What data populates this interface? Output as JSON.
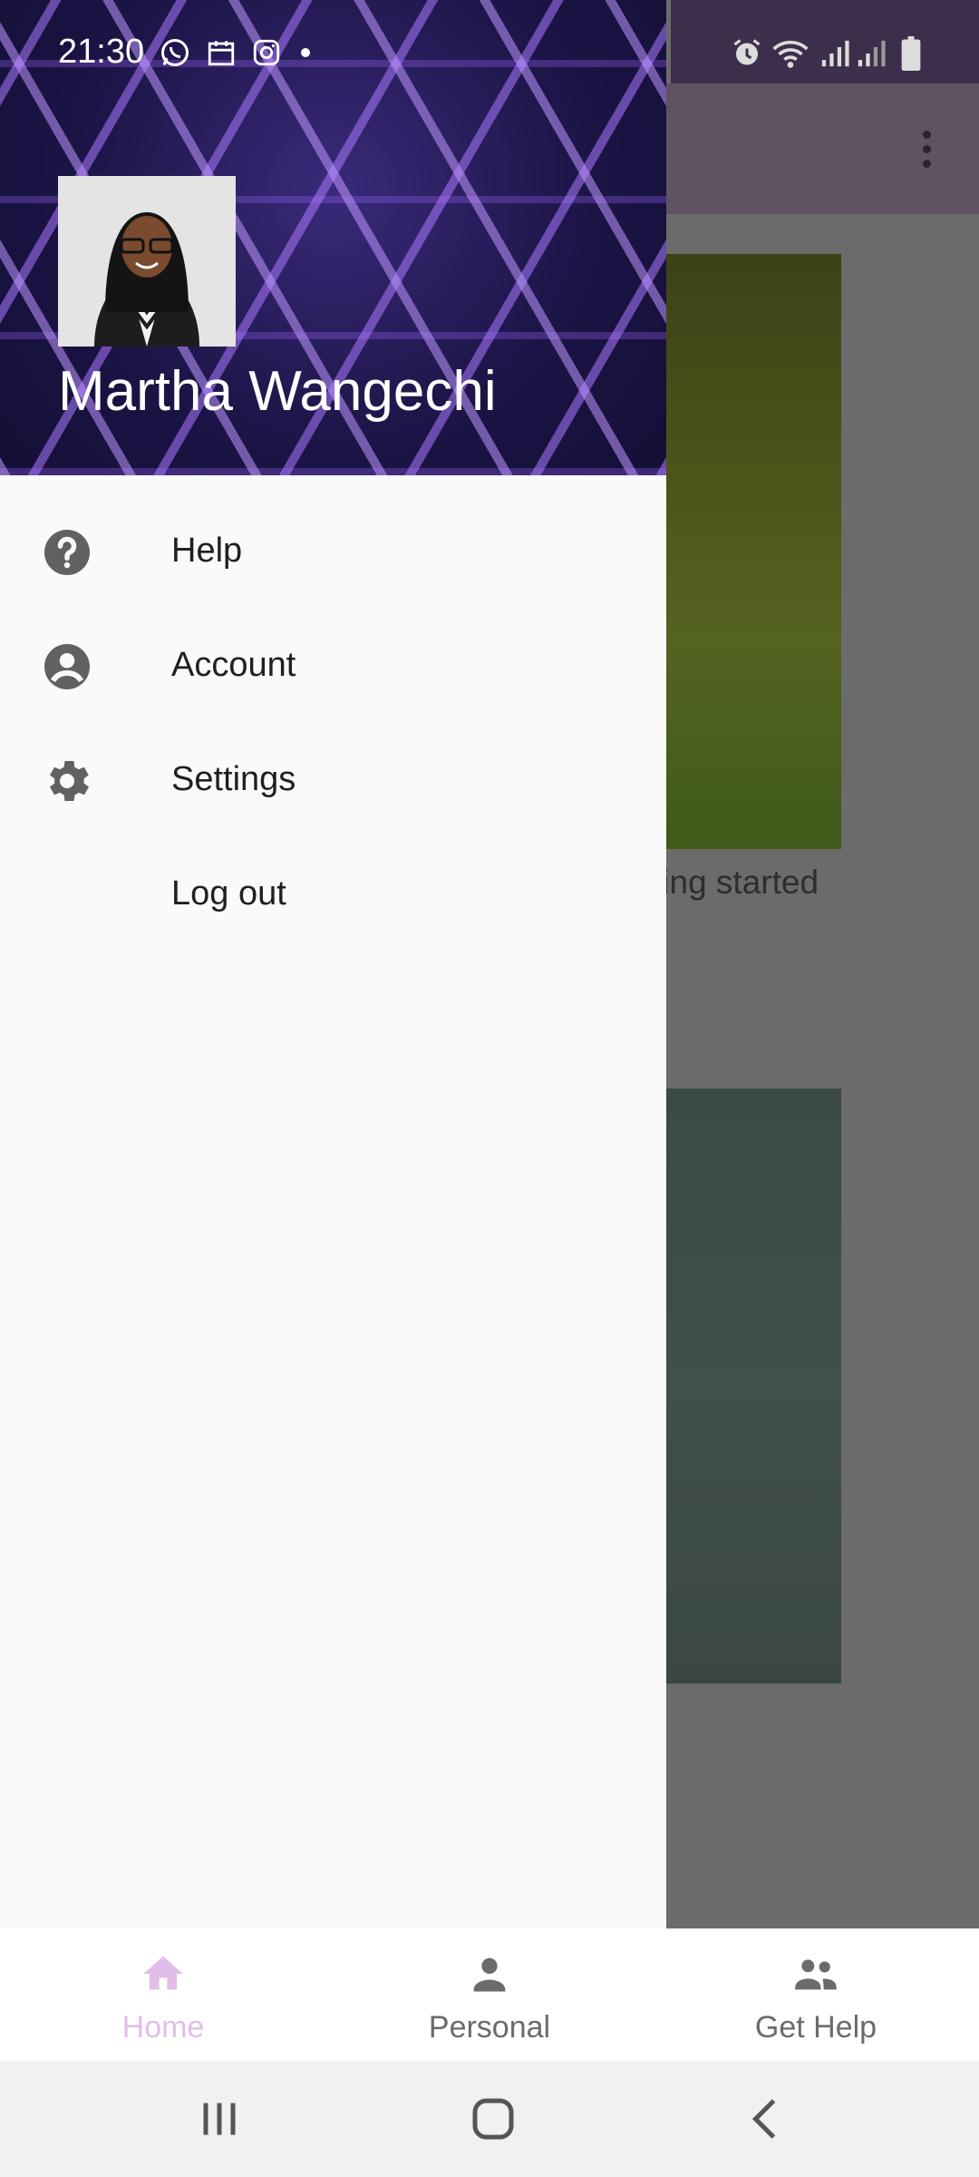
{
  "status_bar": {
    "time": "21:30",
    "left_icons": [
      "whatsapp-icon",
      "calendar-icon",
      "instagram-icon",
      "dot-icon"
    ],
    "right_icons": [
      "alarm-icon",
      "wifi-icon",
      "signal-icon",
      "signal-icon",
      "battery-icon"
    ]
  },
  "drawer": {
    "user_name": "Martha Wangechi",
    "items": [
      {
        "label": "Help",
        "icon": "help-icon"
      },
      {
        "label": "Account",
        "icon": "account-icon"
      },
      {
        "label": "Settings",
        "icon": "settings-icon"
      },
      {
        "label": "Log out",
        "icon": ""
      }
    ]
  },
  "background": {
    "card1_caption": "ting started"
  },
  "bottom_nav": {
    "items": [
      {
        "label": "Home",
        "icon": "home-icon",
        "active": true
      },
      {
        "label": "Personal",
        "icon": "person-icon",
        "active": false
      },
      {
        "label": "Get Help",
        "icon": "group-icon",
        "active": false
      }
    ]
  },
  "system_nav": {
    "buttons": [
      "recents-button",
      "home-button",
      "back-button"
    ]
  },
  "colors": {
    "active_nav": "#e1bee7",
    "inactive_nav": "#6b6b6b",
    "drawer_bg": "#fafafa",
    "toolbar": "#5f5262",
    "menu_icon": "#616161"
  }
}
